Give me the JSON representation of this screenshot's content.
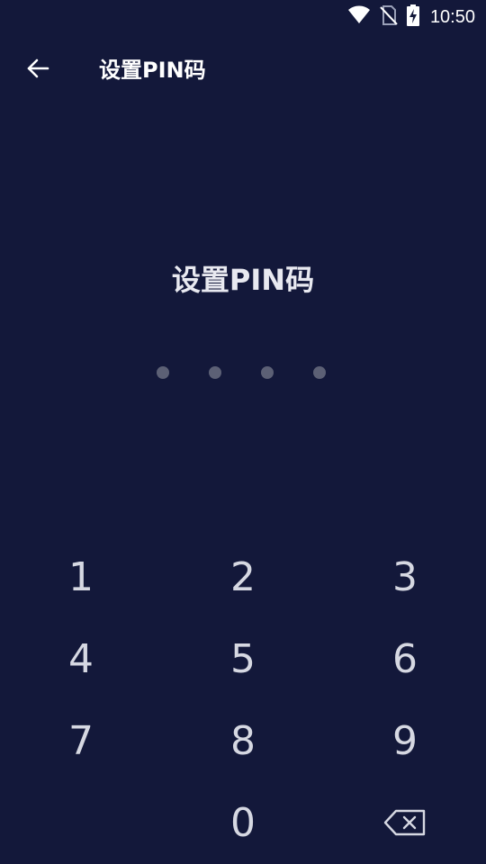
{
  "status_bar": {
    "time": "10:50",
    "icons": [
      "wifi-icon",
      "no-sim-icon",
      "battery-charging-icon"
    ]
  },
  "toolbar": {
    "back_icon": "arrow-left-icon",
    "title": "设置PIN码"
  },
  "main": {
    "heading": "设置PIN码",
    "pin_length": 4,
    "pin_entered": 0
  },
  "keypad": {
    "keys": [
      "1",
      "2",
      "3",
      "4",
      "5",
      "6",
      "7",
      "8",
      "9",
      "",
      "0"
    ],
    "backspace_icon": "backspace-icon"
  },
  "colors": {
    "background": "#13183a",
    "dot_empty": "#5c6075",
    "text": "#ffffff",
    "key_text": "#d6d8e2"
  }
}
